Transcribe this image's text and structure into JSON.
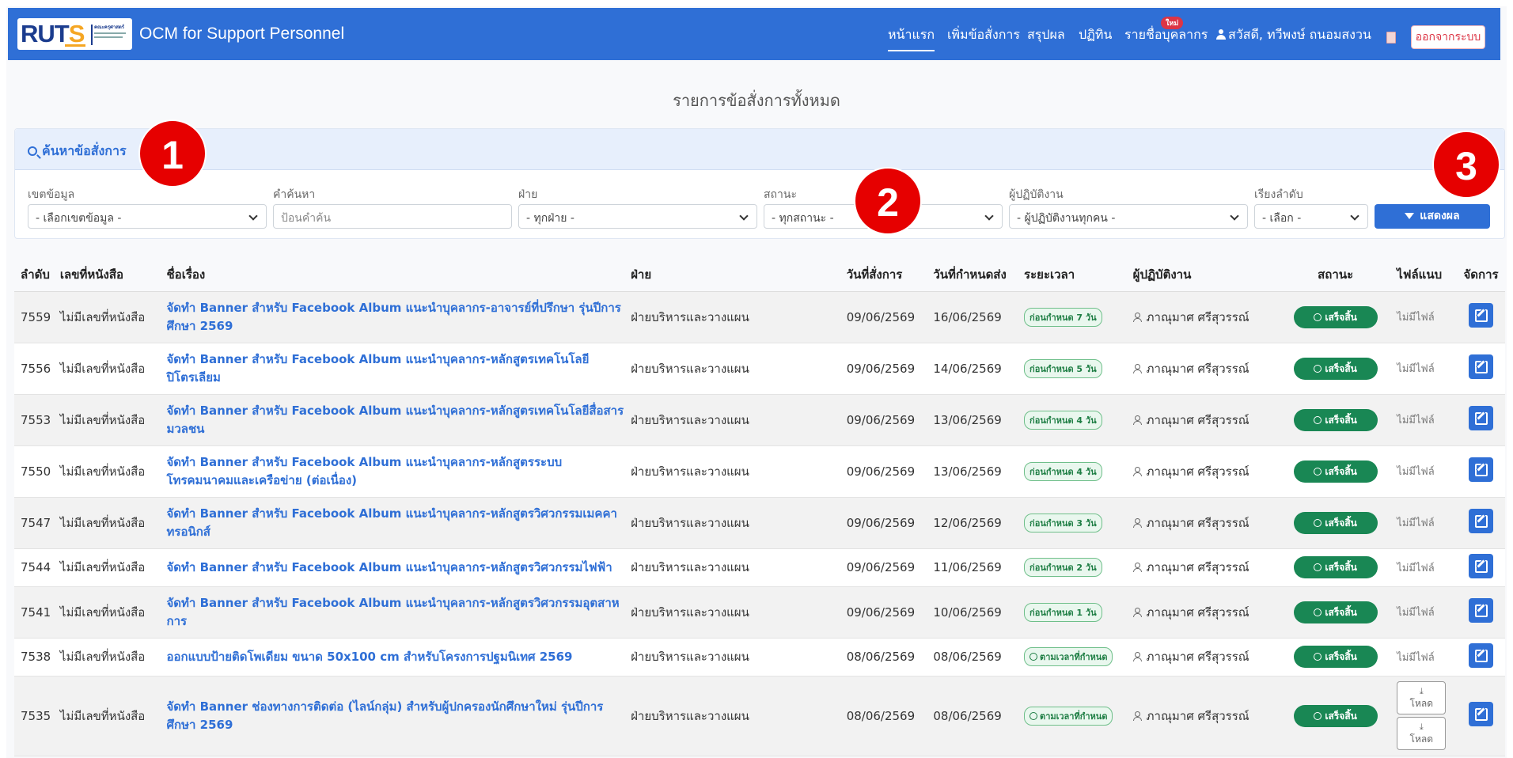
{
  "brand": {
    "logo_text": "RUTS",
    "logo_sub": "คณะครุศาสตร์",
    "title": "OCM for Support Personnel"
  },
  "nav": {
    "home": "หน้าแรก",
    "add": "เพิ่มข้อสั่งการ",
    "summary": "สรุปผล",
    "calendar": "ปฏิทิน",
    "calendar_badge": "ใหม่",
    "staff": "รายชื่อบุคลากร",
    "user": "สวัสดี, ทวีพงษ์ ถนอมสงวน",
    "logout": "ออกจากระบบ"
  },
  "heading": "รายการข้อสั่งการทั้งหมด",
  "search": {
    "title": "ค้นหาข้อสั่งการ",
    "scope": {
      "label": "เขตข้อมูล",
      "value": "- เลือกเขตข้อมูล -"
    },
    "keyword": {
      "label": "คำค้นหา",
      "placeholder": "ป้อนคำค้น"
    },
    "dept": {
      "label": "ฝ่าย",
      "value": "- ทุกฝ่าย -"
    },
    "status": {
      "label": "สถานะ",
      "value": "- ทุกสถานะ -"
    },
    "assignee": {
      "label": "ผู้ปฏิบัติงาน",
      "value": "- ผู้ปฏิบัติงานทุกคน -"
    },
    "sort": {
      "label": "เรียงลำดับ",
      "value": "- เลือก -"
    },
    "show_button": "แสดงผล"
  },
  "callouts": [
    "1",
    "2",
    "3"
  ],
  "table": {
    "headers": [
      "ลำดับ",
      "เลขที่หนังสือ",
      "ชื่อเรื่อง",
      "ฝ่าย",
      "วันที่สั่งการ",
      "วันที่กำหนดส่ง",
      "ระยะเวลา",
      "ผู้ปฏิบัติงาน",
      "สถานะ",
      "ไฟล์แนบ",
      "จัดการ"
    ],
    "rows": [
      {
        "id": "7559",
        "doc": "ไม่มีเลขที่หนังสือ",
        "title": "จัดทำ Banner สำหรับ Facebook Album แนะนำบุคลากร-อาจารย์ที่ปรึกษา รุ่นปีการศึกษา 2569",
        "dept": "ฝ่ายบริหารและวางแผน",
        "ordered": "09/06/2569",
        "due": "16/06/2569",
        "time": "ก่อนกำหนด 7 วัน",
        "person": "ภาณุมาศ ศรีสุวรรณ์",
        "status": "เสร็จสิ้น",
        "file": "ไม่มีไฟล์"
      },
      {
        "id": "7556",
        "doc": "ไม่มีเลขที่หนังสือ",
        "title": "จัดทำ Banner สำหรับ Facebook Album แนะนำบุคลากร-หลักสูตรเทคโนโลยีปิโตรเลียม",
        "dept": "ฝ่ายบริหารและวางแผน",
        "ordered": "09/06/2569",
        "due": "14/06/2569",
        "time": "ก่อนกำหนด 5 วัน",
        "person": "ภาณุมาศ ศรีสุวรรณ์",
        "status": "เสร็จสิ้น",
        "file": "ไม่มีไฟล์"
      },
      {
        "id": "7553",
        "doc": "ไม่มีเลขที่หนังสือ",
        "title": "จัดทำ Banner สำหรับ Facebook Album แนะนำบุคลากร-หลักสูตรเทคโนโลยีสื่อสารมวลชน",
        "dept": "ฝ่ายบริหารและวางแผน",
        "ordered": "09/06/2569",
        "due": "13/06/2569",
        "time": "ก่อนกำหนด 4 วัน",
        "person": "ภาณุมาศ ศรีสุวรรณ์",
        "status": "เสร็จสิ้น",
        "file": "ไม่มีไฟล์"
      },
      {
        "id": "7550",
        "doc": "ไม่มีเลขที่หนังสือ",
        "title": "จัดทำ Banner สำหรับ Facebook Album แนะนำบุคลากร-หลักสูตรระบบโทรคมนาคมและเครือข่าย (ต่อเนื่อง)",
        "dept": "ฝ่ายบริหารและวางแผน",
        "ordered": "09/06/2569",
        "due": "13/06/2569",
        "time": "ก่อนกำหนด 4 วัน",
        "person": "ภาณุมาศ ศรีสุวรรณ์",
        "status": "เสร็จสิ้น",
        "file": "ไม่มีไฟล์"
      },
      {
        "id": "7547",
        "doc": "ไม่มีเลขที่หนังสือ",
        "title": "จัดทำ Banner สำหรับ Facebook Album แนะนำบุคลากร-หลักสูตรวิศวกรรมเมคคาทรอนิกส์",
        "dept": "ฝ่ายบริหารและวางแผน",
        "ordered": "09/06/2569",
        "due": "12/06/2569",
        "time": "ก่อนกำหนด 3 วัน",
        "person": "ภาณุมาศ ศรีสุวรรณ์",
        "status": "เสร็จสิ้น",
        "file": "ไม่มีไฟล์"
      },
      {
        "id": "7544",
        "doc": "ไม่มีเลขที่หนังสือ",
        "title": "จัดทำ Banner สำหรับ Facebook Album แนะนำบุคลากร-หลักสูตรวิศวกรรมไฟฟ้า",
        "dept": "ฝ่ายบริหารและวางแผน",
        "ordered": "09/06/2569",
        "due": "11/06/2569",
        "time": "ก่อนกำหนด 2 วัน",
        "person": "ภาณุมาศ ศรีสุวรรณ์",
        "status": "เสร็จสิ้น",
        "file": "ไม่มีไฟล์"
      },
      {
        "id": "7541",
        "doc": "ไม่มีเลขที่หนังสือ",
        "title": "จัดทำ Banner สำหรับ Facebook Album แนะนำบุคลากร-หลักสูตรวิศวกรรมอุตสาหการ",
        "dept": "ฝ่ายบริหารและวางแผน",
        "ordered": "09/06/2569",
        "due": "10/06/2569",
        "time": "ก่อนกำหนด 1 วัน",
        "person": "ภาณุมาศ ศรีสุวรรณ์",
        "status": "เสร็จสิ้น",
        "file": "ไม่มีไฟล์"
      },
      {
        "id": "7538",
        "doc": "ไม่มีเลขที่หนังสือ",
        "title": "ออกแบบป้ายติดโพเดียม ขนาด 50x100 cm สำหรับโครงการปฐมนิเทศ 2569",
        "dept": "ฝ่ายบริหารและวางแผน",
        "ordered": "08/06/2569",
        "due": "08/06/2569",
        "time": "ตามเวลาที่กำหนด",
        "person": "ภาณุมาศ ศรีสุวรรณ์",
        "status": "เสร็จสิ้น",
        "file": "ไม่มีไฟล์"
      },
      {
        "id": "7535",
        "doc": "ไม่มีเลขที่หนังสือ",
        "title": "จัดทำ Banner ช่องทางการติดต่อ (ไลน์กลุ่ม) สำหรับผู้ปกครองนักศึกษาใหม่ รุ่นปีการศึกษา 2569",
        "dept": "ฝ่ายบริหารและวางแผน",
        "ordered": "08/06/2569",
        "due": "08/06/2569",
        "time": "ตามเวลาที่กำหนด",
        "person": "ภาณุมาศ ศรีสุวรรณ์",
        "status": "เสร็จสิ้น",
        "file": "",
        "downloads": [
          "โหลด",
          "โหลด"
        ]
      }
    ]
  },
  "colors": {
    "navbar": "#2f6fd6",
    "primary": "#2f6fd6",
    "success": "#198754",
    "danger": "#dc3545",
    "callout": "#e60000"
  },
  "icons": {
    "search": "search-icon",
    "user": "user-icon",
    "filter": "filter-icon",
    "edit": "edit-icon",
    "download": "download-icon",
    "check": "check-circle-icon",
    "person": "person-icon"
  }
}
